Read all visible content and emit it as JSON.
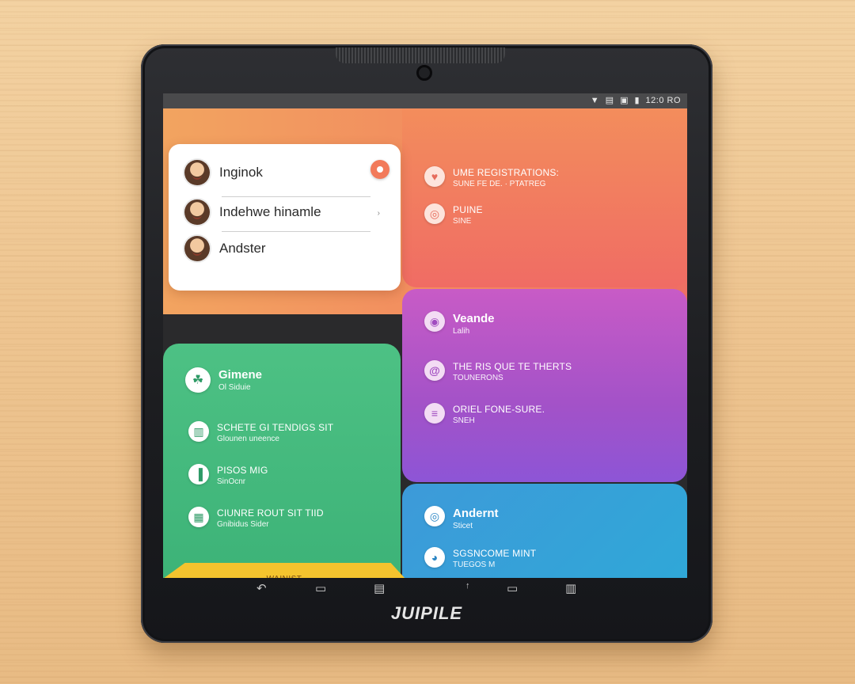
{
  "device": {
    "brand": "JUIPILE"
  },
  "status_bar": {
    "icons": [
      "wifi-icon",
      "signal-icon",
      "sim-icon",
      "battery-icon"
    ],
    "text": "12:0 RO"
  },
  "contacts": {
    "items": [
      {
        "name": "Inginok"
      },
      {
        "name": "Indehwe hinamle"
      },
      {
        "name": "Andster"
      }
    ]
  },
  "orange_panel": {
    "rows": [
      {
        "line1": "UME REGISTRATIONS:",
        "line2": "SUNE FE DE. · PTATREG",
        "icon": "heart-icon"
      },
      {
        "line1": "PUINE",
        "line2": "SINE",
        "icon": "location-icon"
      }
    ]
  },
  "purple_panel": {
    "title": "Veande",
    "subtitle": "Lalih",
    "rows": [
      {
        "line1": "THE RIS QUE TE THERTS",
        "line2": "TOUNERONS",
        "icon": "at-icon"
      },
      {
        "line1": "ORIEL FONE-SURE.",
        "line2": "SNEH",
        "icon": "list-icon"
      }
    ]
  },
  "green_panel": {
    "title": "Gimene",
    "subtitle": "Ol Siduie",
    "rows": [
      {
        "line1": "SCHETE GI TENDIGS SIT",
        "line2": "Glounen uneence",
        "icon": "chart-icon"
      },
      {
        "line1": "PISOS MIG",
        "line2": "SinOcnr",
        "icon": "bars-icon"
      },
      {
        "line1": "CIUNRE ROUT SIT TIID",
        "line2": "Gnibidus Sider",
        "icon": "grid-icon"
      }
    ],
    "button": "WAINIST"
  },
  "blue_panel": {
    "title": "Andernt",
    "subtitle": "Sticet",
    "rows": [
      {
        "line1": "SGSNCOME MINT",
        "line2": "TUEGOS M",
        "icon": "chat-icon"
      }
    ]
  },
  "nav_bar": {
    "icons": [
      "back-icon",
      "home-icon",
      "recent-apps-icon",
      "up-icon",
      "menu-icon",
      "screenshot-icon"
    ]
  },
  "colors": {
    "orange": "#f28b5f",
    "purple": "#a352c8",
    "blue": "#2fa8d8",
    "green": "#4dc184",
    "yellow": "#f4c32e"
  }
}
